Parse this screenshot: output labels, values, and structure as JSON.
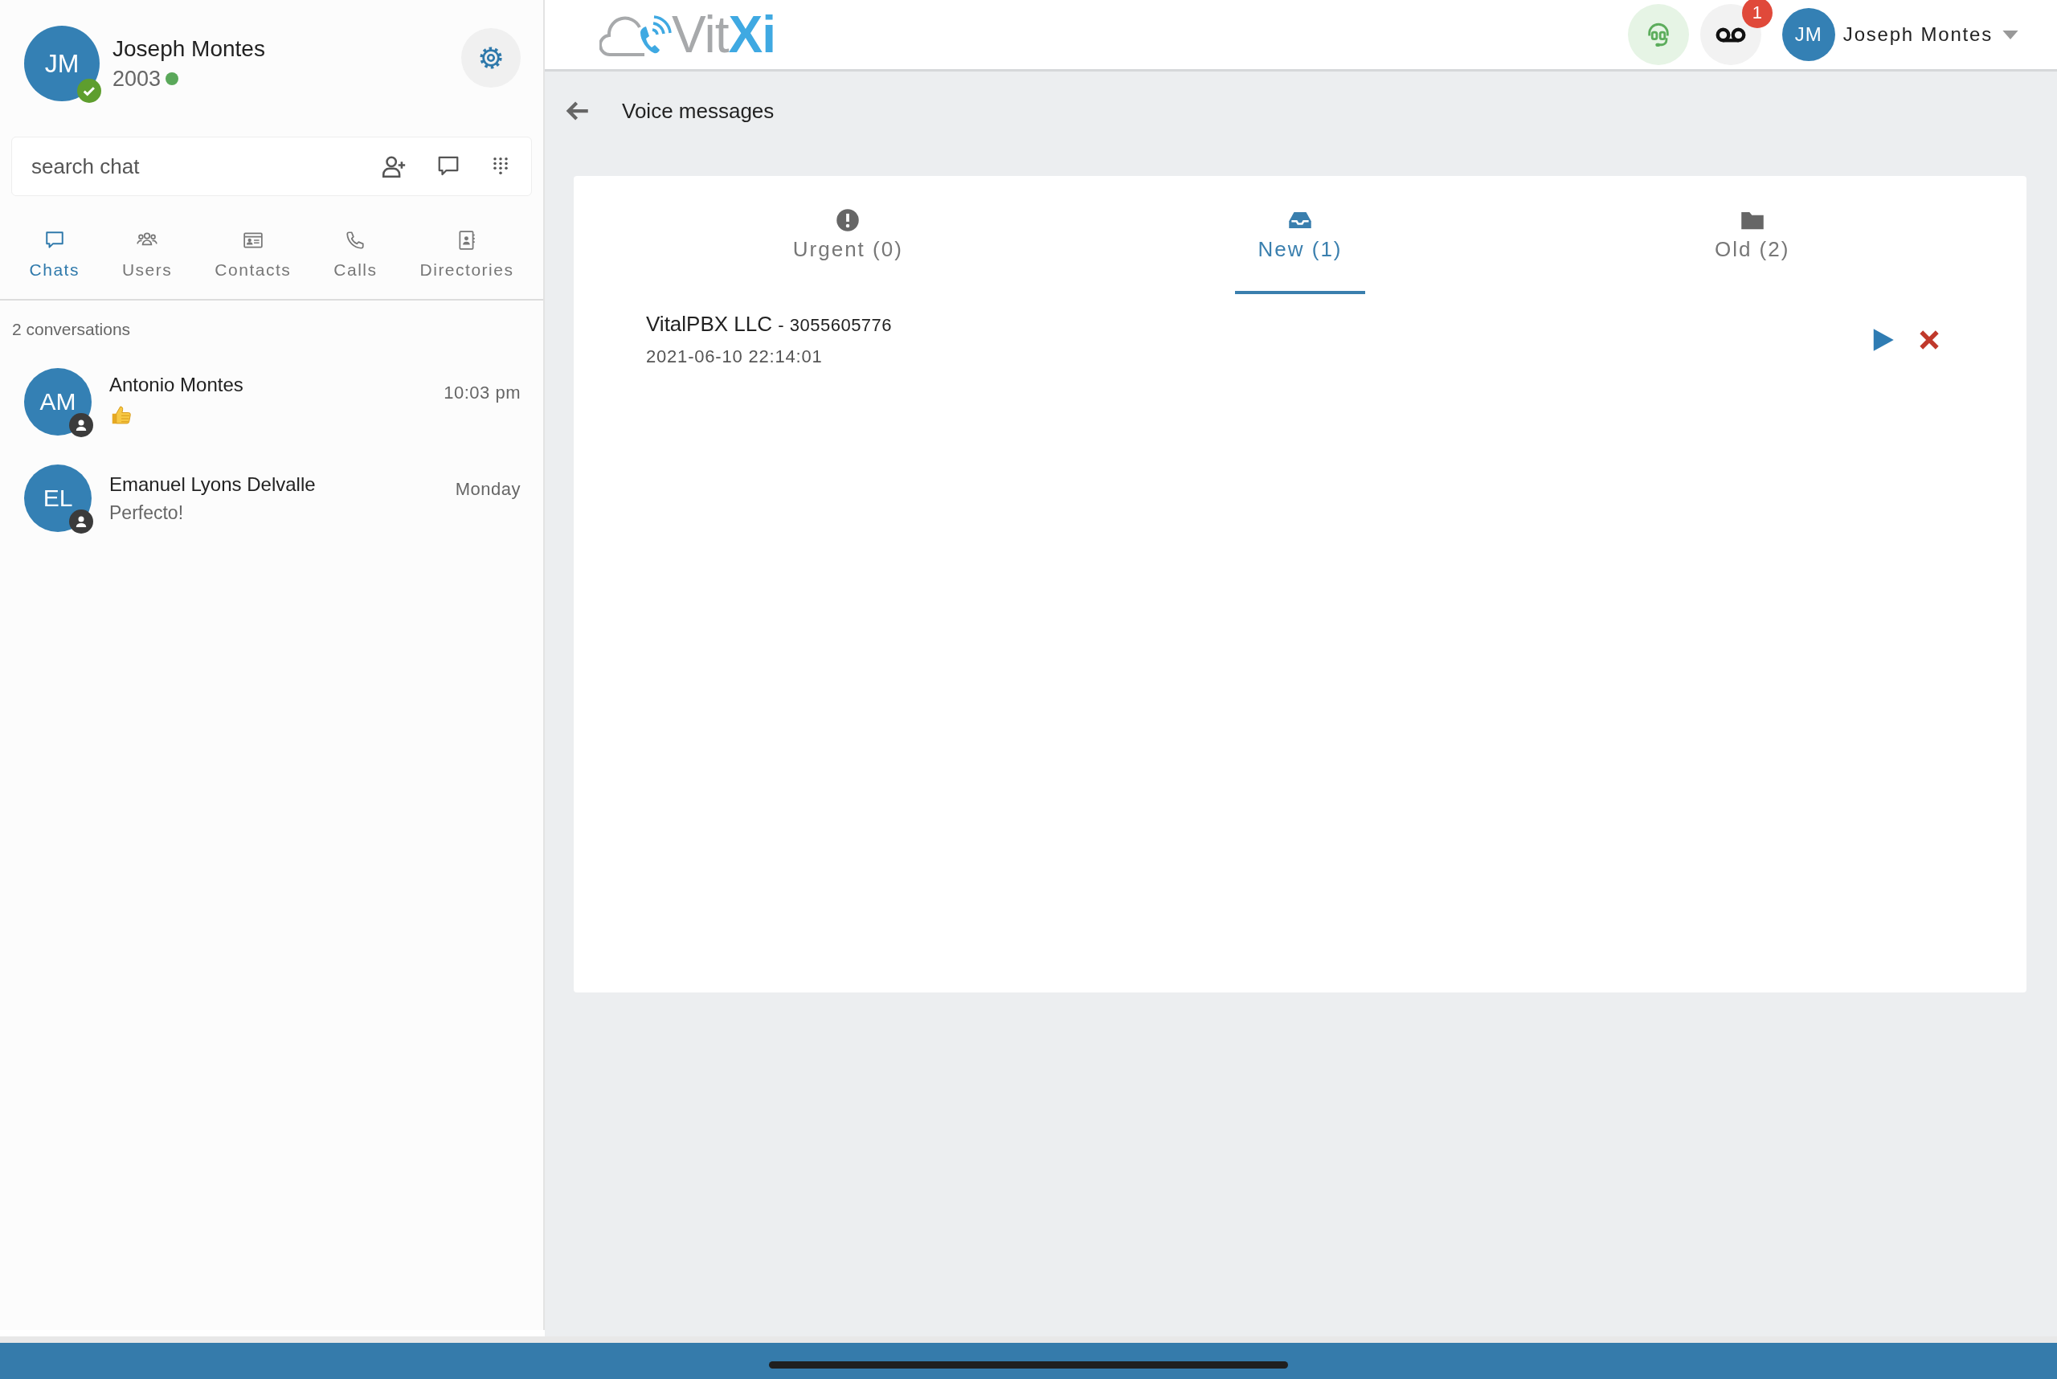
{
  "user": {
    "initials": "JM",
    "name": "Joseph Montes",
    "extension": "2003",
    "online": true
  },
  "search": {
    "placeholder": "search chat"
  },
  "sidebar_tabs": [
    {
      "label": "Chats",
      "selected": true
    },
    {
      "label": "Users",
      "selected": false
    },
    {
      "label": "Contacts",
      "selected": false
    },
    {
      "label": "Calls",
      "selected": false
    },
    {
      "label": "Directories",
      "selected": false
    }
  ],
  "conversation_count": "2 conversations",
  "conversations": [
    {
      "initials": "AM",
      "name": "Antonio Montes",
      "time": "10:03 pm",
      "last_message": {
        "kind": "thumbs_up"
      }
    },
    {
      "initials": "EL",
      "name": "Emanuel Lyons Delvalle",
      "time": "Monday",
      "last_message": {
        "kind": "text",
        "text": "Perfecto!"
      }
    }
  ],
  "logo": {
    "parts": [
      {
        "text": "Vit",
        "color": "#a7a9ab"
      },
      {
        "text": "Xi",
        "color": "#3fa9e2"
      }
    ]
  },
  "header": {
    "voicemail_badge": "1",
    "initials": "JM",
    "name": "Joseph Montes"
  },
  "page_title": "Voice messages",
  "voicemail_tabs": [
    {
      "label": "Urgent (0)",
      "selected": false
    },
    {
      "label": "New (1)",
      "selected": true
    },
    {
      "label": "Old (2)",
      "selected": false
    }
  ],
  "messages": [
    {
      "caller": "VitalPBX LLC",
      "number": "- 3055605776",
      "date": "2021-06-10 22:14:01"
    }
  ]
}
